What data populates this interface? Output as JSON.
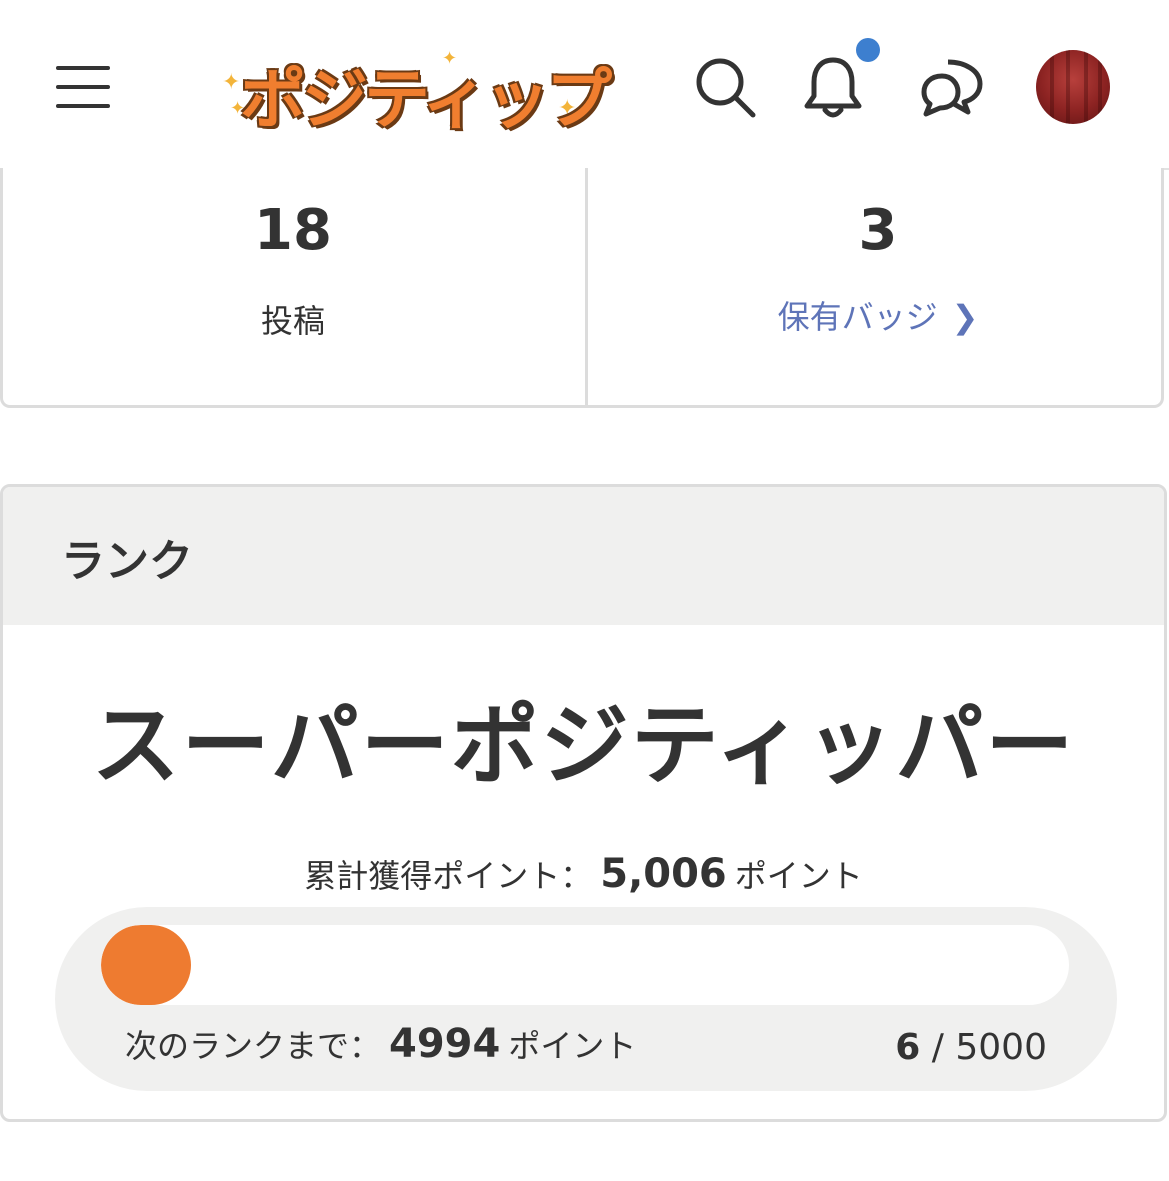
{
  "header": {
    "logo_text": "ポジティップ",
    "notification_unread": true,
    "colors": {
      "logo_orange": "#f07e2f",
      "notification_dot": "#3d7fcf"
    }
  },
  "stats": {
    "posts_count": "18",
    "posts_label": "投稿",
    "badges_count": "3",
    "badges_label": "保有バッジ",
    "badges_chevron": "❯"
  },
  "rank": {
    "section_title": "ランク",
    "rank_name": "スーパーポジティッパー",
    "total_label": "累計獲得ポイント：",
    "total_value": "5,006",
    "total_unit": "ポイント",
    "next_label": "次のランクまで：",
    "next_value": "4994",
    "next_unit": "ポイント",
    "progress_current": "6",
    "progress_separator": " / ",
    "progress_target": "5000",
    "progress_fraction": 0.0012,
    "colors": {
      "progress_fill": "#ee7b30",
      "panel_bg": "#f0f0ef",
      "link_blue": "#5e74b8"
    }
  }
}
